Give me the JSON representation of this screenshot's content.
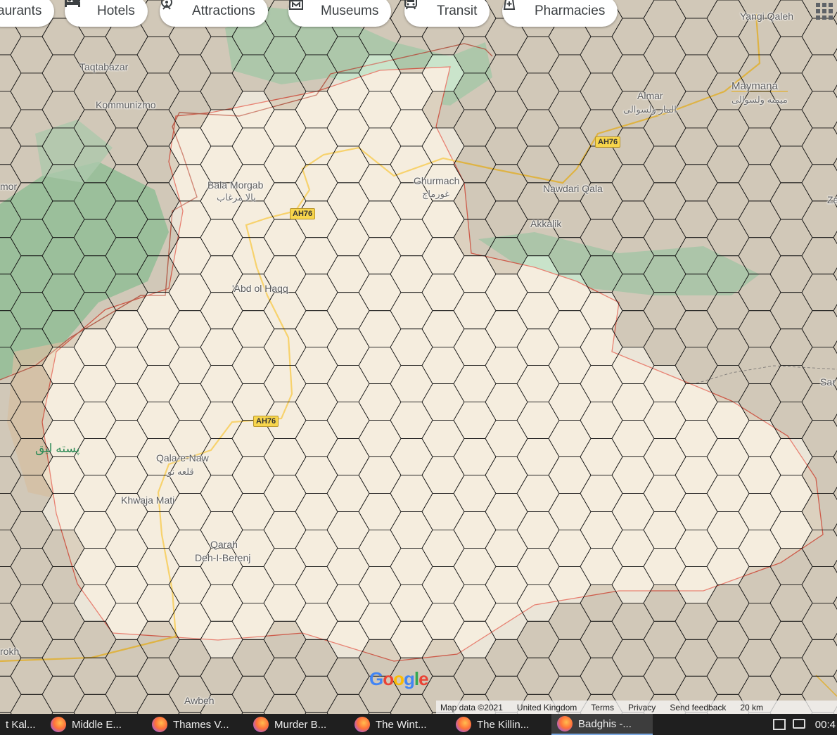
{
  "chips": [
    {
      "label": "aurants",
      "icon": "restaurant-icon"
    },
    {
      "label": "Hotels",
      "icon": "hotel-bed-icon"
    },
    {
      "label": "Attractions",
      "icon": "attractions-icon"
    },
    {
      "label": "Museums",
      "icon": "museum-icon"
    },
    {
      "label": "Transit",
      "icon": "transit-bus-icon"
    },
    {
      "label": "Pharmacies",
      "icon": "pharmacy-icon"
    }
  ],
  "places": {
    "yangi_qaleh": "Yangi Qaleh",
    "taqtabazar": "Taqtabazar",
    "kommunizm": "Kommunizmo",
    "almar": "Almar",
    "almar_ar": "المار ولسوالی",
    "maymana": "Maymana",
    "maymana_ar": "میمنه ولسوالی",
    "mor": "mor",
    "bala_morgab": "Bala Morgab",
    "bala_morgab_ar": "بالا مرغاب",
    "ghurmach": "Ghurmach",
    "ghurmach_ar": "غورماچ",
    "nawdari_qala": "Nawdari Qala",
    "akkalik": "Akkalik",
    "abd_ol_haqq": "'Abd ol Haqq",
    "pesta_liq": "پسته لیق",
    "qala_e_naw": "Qala-e-Naw",
    "qala_e_naw_ar": "قلعه نو",
    "khwaja_mati": "Khwaja Mati",
    "qarah": "Qarah",
    "deh_i_berenj": "Deh-I-Berenj",
    "rokh": "rokh",
    "awbeh": "Awbeh",
    "za": "Za",
    "sar": "Sar"
  },
  "road_shields": [
    "AH76",
    "AH76",
    "AH76"
  ],
  "attribution": {
    "map_data": "Map data ©2021",
    "region": "United Kingdom",
    "terms": "Terms",
    "privacy": "Privacy",
    "feedback": "Send feedback",
    "scale": "20 km"
  },
  "google_logo": [
    "G",
    "o",
    "o",
    "g",
    "l",
    "e"
  ],
  "taskbar": {
    "items": [
      {
        "label": "t Kal..."
      },
      {
        "label": "Middle E..."
      },
      {
        "label": "Thames V..."
      },
      {
        "label": "Murder B..."
      },
      {
        "label": "The Wint..."
      },
      {
        "label": "The Killin..."
      },
      {
        "label": "Badghis -..."
      }
    ],
    "clock": "00:4"
  },
  "colors": {
    "land": "#e9e2d3",
    "region_fill": "#f3ead9",
    "forest": "#a9d7b3",
    "road": "#f5c542",
    "border": "#e05a4a",
    "hex_line": "#111111"
  }
}
